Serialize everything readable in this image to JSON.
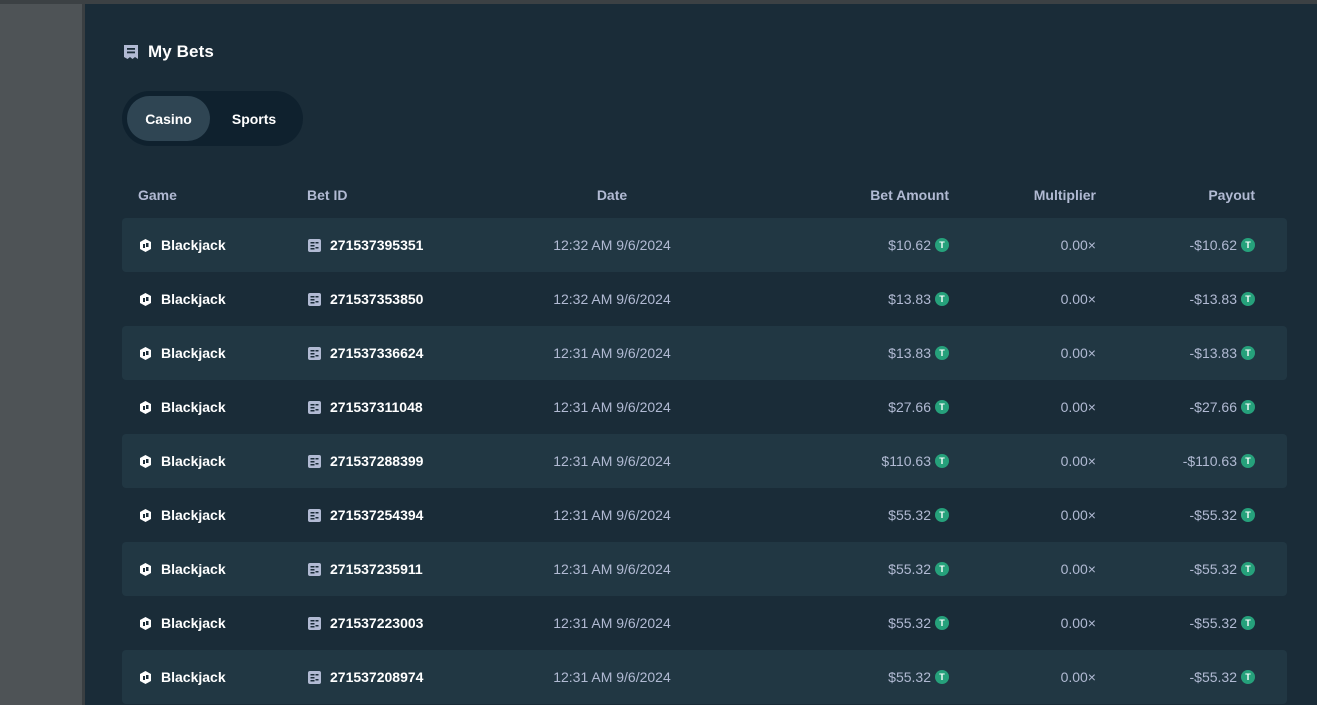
{
  "page": {
    "title": "My Bets",
    "title_icon": "receipt-icon"
  },
  "tabs": [
    {
      "label": "Casino",
      "active": true
    },
    {
      "label": "Sports",
      "active": false
    }
  ],
  "table": {
    "headers": {
      "game": "Game",
      "bet_id": "Bet ID",
      "date": "Date",
      "bet_amount": "Bet Amount",
      "multiplier": "Multiplier",
      "payout": "Payout"
    },
    "currency_icon": "tether-coin-icon",
    "currency_glyph": "T",
    "rows": [
      {
        "game": "Blackjack",
        "bet_id": "271537395351",
        "date": "12:32 AM 9/6/2024",
        "bet_amount": "$10.62",
        "multiplier": "0.00×",
        "payout": "-$10.62"
      },
      {
        "game": "Blackjack",
        "bet_id": "271537353850",
        "date": "12:32 AM 9/6/2024",
        "bet_amount": "$13.83",
        "multiplier": "0.00×",
        "payout": "-$13.83"
      },
      {
        "game": "Blackjack",
        "bet_id": "271537336624",
        "date": "12:31 AM 9/6/2024",
        "bet_amount": "$13.83",
        "multiplier": "0.00×",
        "payout": "-$13.83"
      },
      {
        "game": "Blackjack",
        "bet_id": "271537311048",
        "date": "12:31 AM 9/6/2024",
        "bet_amount": "$27.66",
        "multiplier": "0.00×",
        "payout": "-$27.66"
      },
      {
        "game": "Blackjack",
        "bet_id": "271537288399",
        "date": "12:31 AM 9/6/2024",
        "bet_amount": "$110.63",
        "multiplier": "0.00×",
        "payout": "-$110.63"
      },
      {
        "game": "Blackjack",
        "bet_id": "271537254394",
        "date": "12:31 AM 9/6/2024",
        "bet_amount": "$55.32",
        "multiplier": "0.00×",
        "payout": "-$55.32"
      },
      {
        "game": "Blackjack",
        "bet_id": "271537235911",
        "date": "12:31 AM 9/6/2024",
        "bet_amount": "$55.32",
        "multiplier": "0.00×",
        "payout": "-$55.32"
      },
      {
        "game": "Blackjack",
        "bet_id": "271537223003",
        "date": "12:31 AM 9/6/2024",
        "bet_amount": "$55.32",
        "multiplier": "0.00×",
        "payout": "-$55.32"
      },
      {
        "game": "Blackjack",
        "bet_id": "271537208974",
        "date": "12:31 AM 9/6/2024",
        "bet_amount": "$55.32",
        "multiplier": "0.00×",
        "payout": "-$55.32"
      }
    ]
  },
  "colors": {
    "background": "#1a2c38",
    "row_alt": "#213743",
    "tab_active": "#2f4553",
    "tab_track": "#0f212e",
    "muted_text": "#b1bad3",
    "coin": "#26a17b"
  }
}
